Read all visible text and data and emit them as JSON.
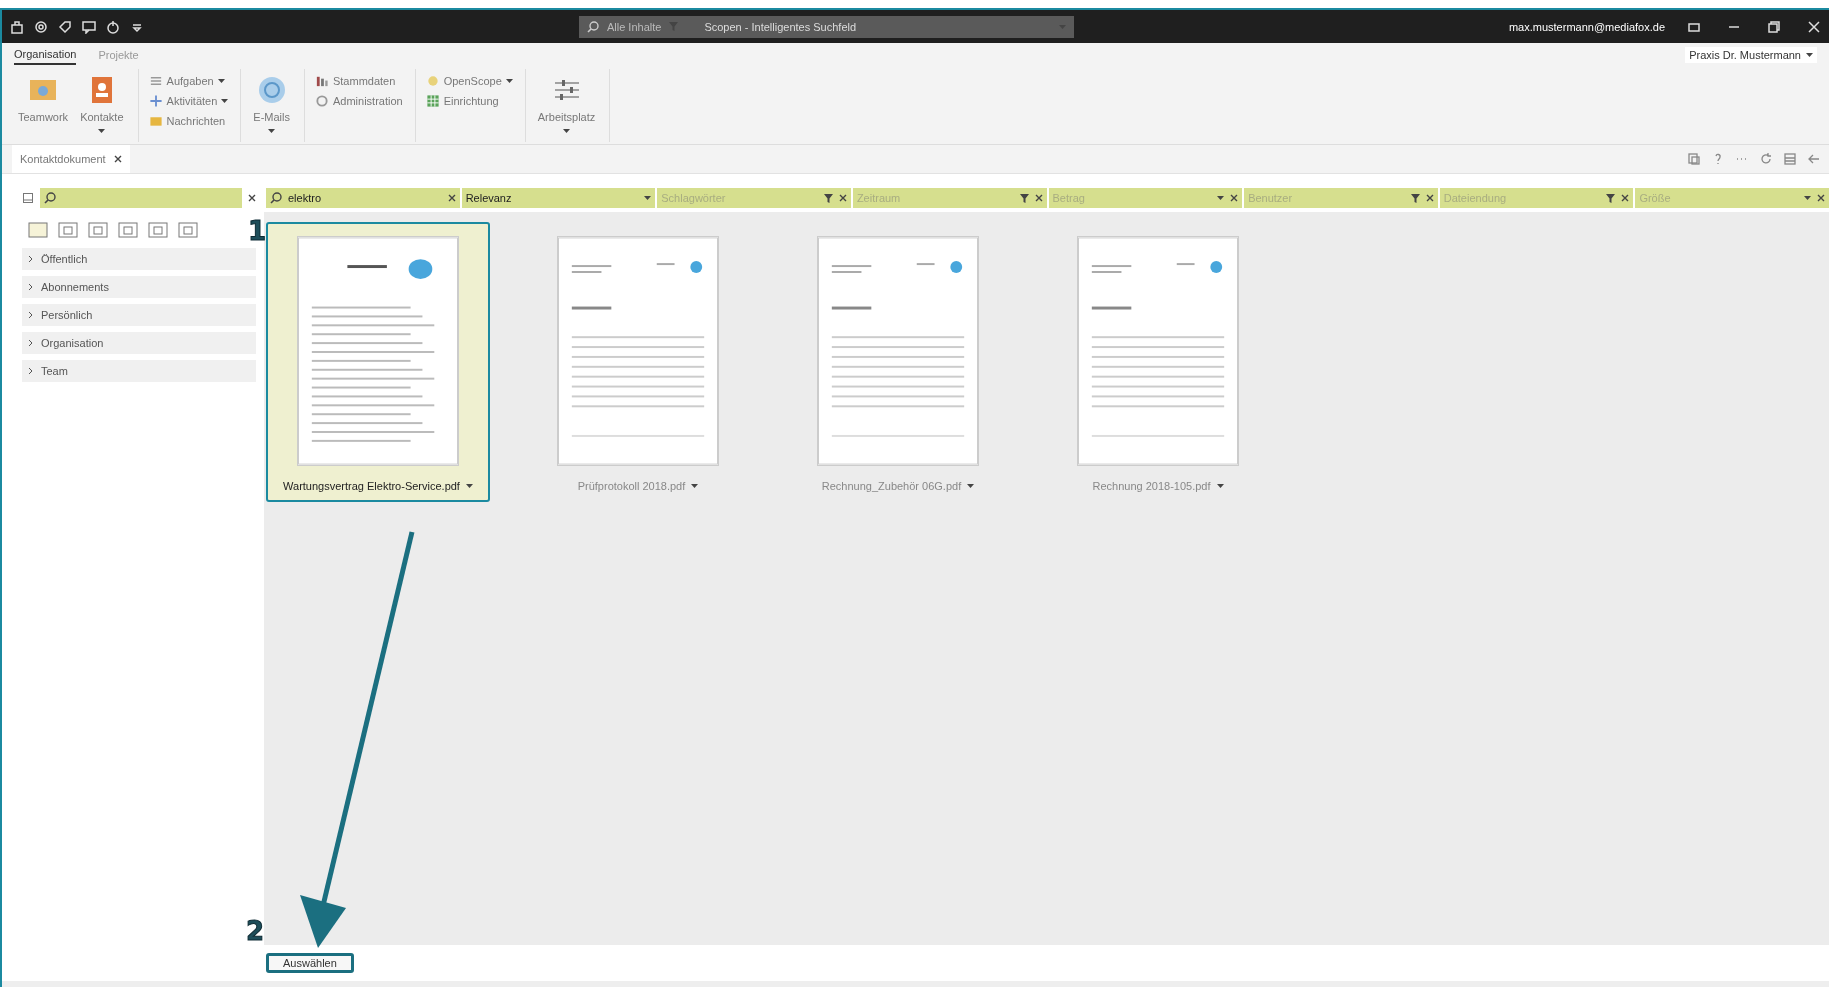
{
  "title_bar": {
    "search_scope": "Alle Inhalte",
    "search_placeholder": "Scopen - Intelligentes Suchfeld",
    "user": "max.mustermann@mediafox.de"
  },
  "ribbon": {
    "tabs": [
      {
        "label": "Organisation",
        "selected": true
      },
      {
        "label": "Projekte",
        "selected": false
      }
    ],
    "organization": "Praxis Dr. Mustermann",
    "groups": [
      {
        "items": [
          {
            "kind": "large",
            "label": "Teamwork",
            "dropdown": false
          },
          {
            "kind": "large",
            "label": "Kontakte",
            "dropdown": true
          }
        ]
      },
      {
        "items": [
          {
            "kind": "small",
            "label": "Aufgaben",
            "dropdown": true
          },
          {
            "kind": "small",
            "label": "Aktivitäten",
            "dropdown": true
          },
          {
            "kind": "small",
            "label": "Nachrichten",
            "dropdown": false
          }
        ]
      },
      {
        "items": [
          {
            "kind": "large",
            "label": "E-Mails",
            "dropdown": true
          }
        ]
      },
      {
        "items": [
          {
            "kind": "small",
            "label": "Stammdaten",
            "dropdown": false
          },
          {
            "kind": "small",
            "label": "Administration",
            "dropdown": false
          }
        ]
      },
      {
        "items": [
          {
            "kind": "small",
            "label": "OpenScope",
            "dropdown": true
          },
          {
            "kind": "small",
            "label": "Einrichtung",
            "dropdown": false
          }
        ]
      },
      {
        "items": [
          {
            "kind": "large",
            "label": "Arbeitsplatz",
            "dropdown": true
          }
        ]
      }
    ]
  },
  "document_tab": {
    "label": "Kontaktdokument"
  },
  "sidebar": {
    "items": [
      {
        "label": "Öffentlich",
        "expanded": false
      },
      {
        "label": "Abonnements",
        "expanded": false
      },
      {
        "label": "Persönlich",
        "expanded": false
      },
      {
        "label": "Organisation",
        "expanded": false
      },
      {
        "label": "Team",
        "expanded": false
      }
    ]
  },
  "search": {
    "value": "elektro"
  },
  "filters": [
    {
      "kind": "sort",
      "label": "Relevanz",
      "filled": true
    },
    {
      "kind": "filter",
      "label": "Schlagwörter",
      "filled": false
    },
    {
      "kind": "filter",
      "label": "Zeitraum",
      "filled": false
    },
    {
      "kind": "dropdown",
      "label": "Betrag",
      "filled": false
    },
    {
      "kind": "filter",
      "label": "Benutzer",
      "filled": false
    },
    {
      "kind": "filter",
      "label": "Dateiendung",
      "filled": false
    },
    {
      "kind": "dropdown",
      "label": "Größe",
      "filled": false
    }
  ],
  "documents": [
    {
      "name": "Wartungsvertrag Elektro-Service.pdf",
      "selected": true,
      "kind": "letter"
    },
    {
      "name": "Prüfprotokoll 2018.pdf",
      "selected": false,
      "kind": "invoice"
    },
    {
      "name": "Rechnung_Zubehör 06G.pdf",
      "selected": false,
      "kind": "invoice"
    },
    {
      "name": "Rechnung 2018-105.pdf",
      "selected": false,
      "kind": "invoice"
    }
  ],
  "select_button": "Auswählen",
  "annotations": [
    "1",
    "2"
  ]
}
